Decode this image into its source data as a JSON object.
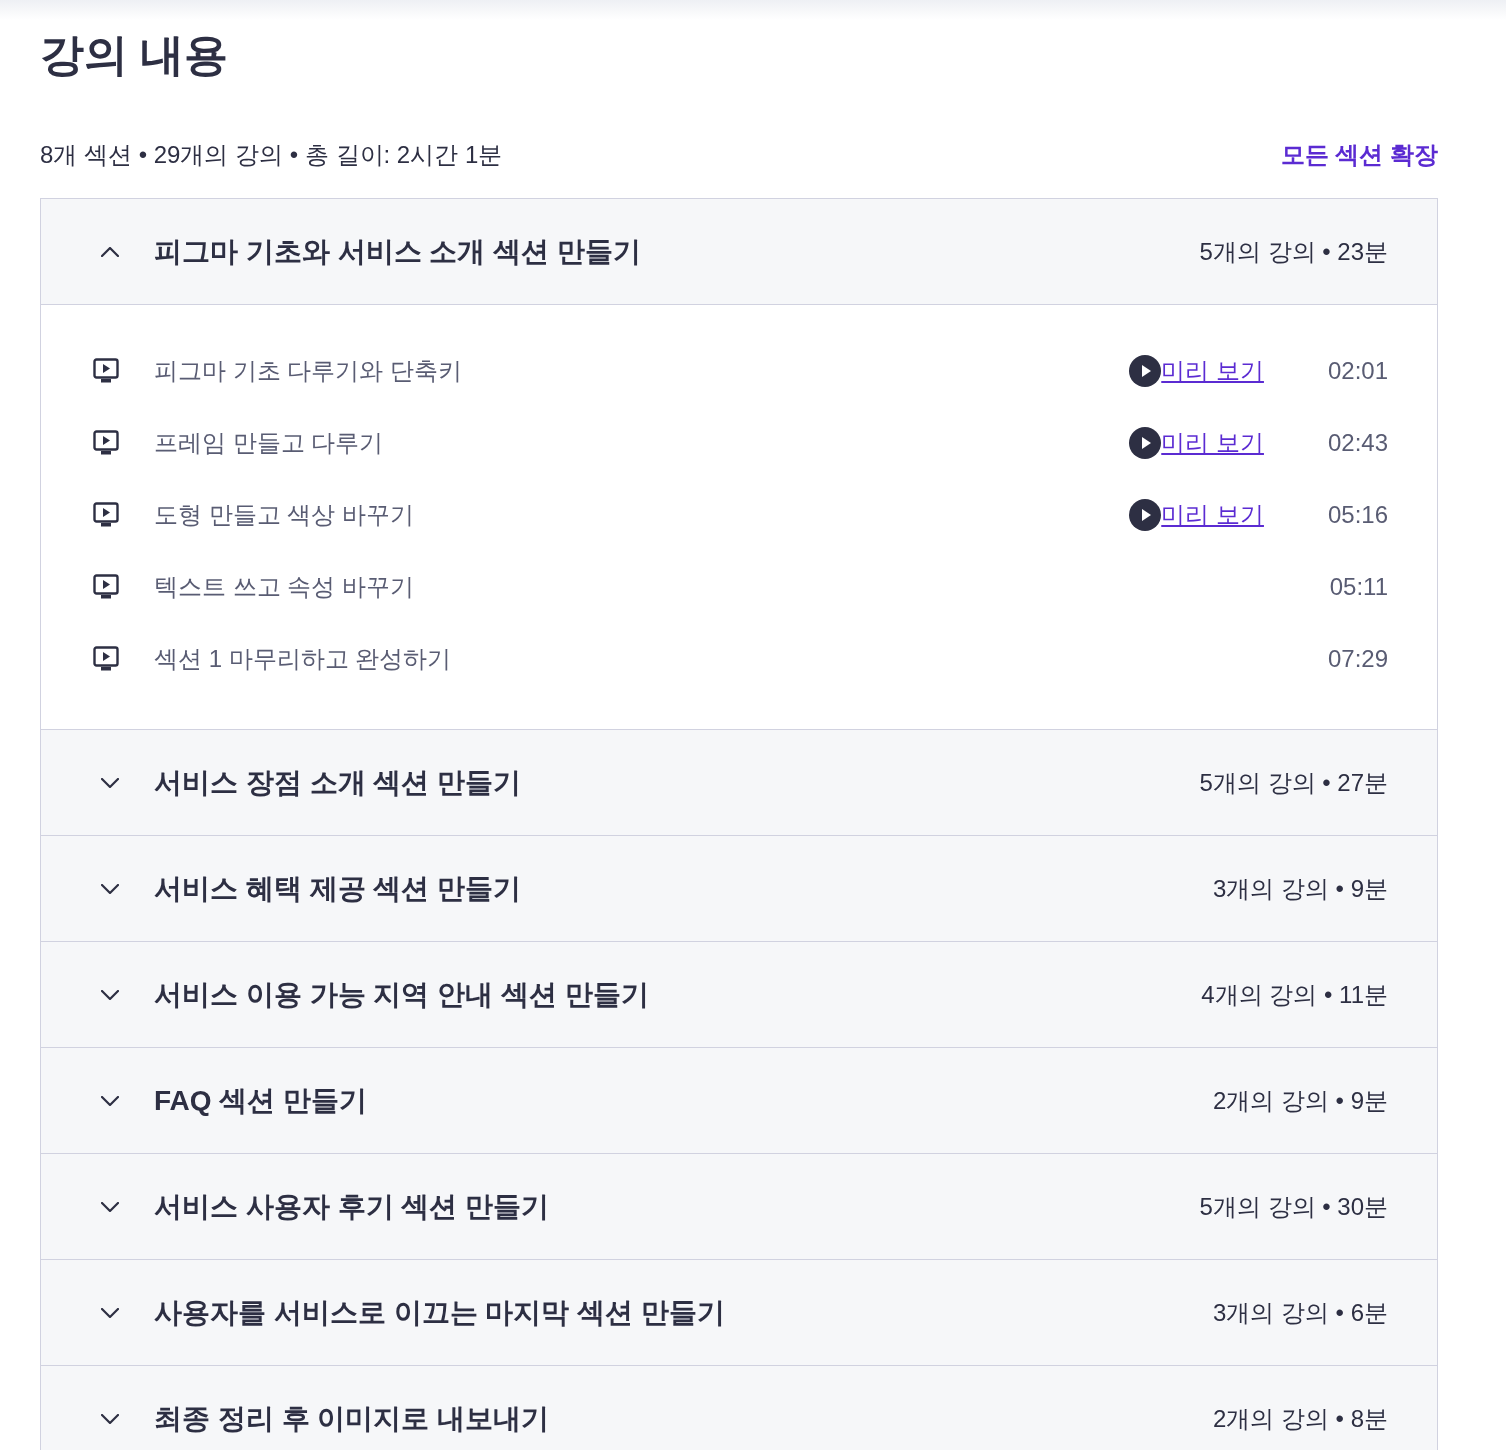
{
  "heading": "강의 내용",
  "summary": "8개 섹션 • 29개의 강의 • 총 길이: 2시간 1분",
  "expand_all": "모든 섹션 확장",
  "sections": [
    {
      "title": "피그마 기초와 서비스 소개 섹션 만들기",
      "meta": "5개의 강의 • 23분",
      "expanded": true,
      "lectures": [
        {
          "title": "피그마 기초 다루기와 단축키",
          "preview": "미리 보기",
          "duration": "02:01"
        },
        {
          "title": "프레임 만들고 다루기",
          "preview": "미리 보기",
          "duration": "02:43"
        },
        {
          "title": "도형 만들고 색상 바꾸기",
          "preview": "미리 보기",
          "duration": "05:16"
        },
        {
          "title": "텍스트 쓰고 속성 바꾸기",
          "duration": "05:11"
        },
        {
          "title": "섹션 1 마무리하고 완성하기",
          "duration": "07:29"
        }
      ]
    },
    {
      "title": "서비스 장점 소개 섹션 만들기",
      "meta": "5개의 강의 • 27분",
      "expanded": false
    },
    {
      "title": "서비스 혜택 제공 섹션 만들기",
      "meta": "3개의 강의 • 9분",
      "expanded": false
    },
    {
      "title": "서비스 이용 가능 지역 안내 섹션 만들기",
      "meta": "4개의 강의 • 11분",
      "expanded": false
    },
    {
      "title": "FAQ 섹션 만들기",
      "meta": "2개의 강의 • 9분",
      "expanded": false
    },
    {
      "title": "서비스 사용자 후기 섹션 만들기",
      "meta": "5개의 강의 • 30분",
      "expanded": false
    },
    {
      "title": "사용자를 서비스로 이끄는 마지막 섹션 만들기",
      "meta": "3개의 강의 • 6분",
      "expanded": false
    },
    {
      "title": "최종 정리 후 이미지로 내보내기",
      "meta": "2개의 강의 • 8분",
      "expanded": false
    }
  ]
}
